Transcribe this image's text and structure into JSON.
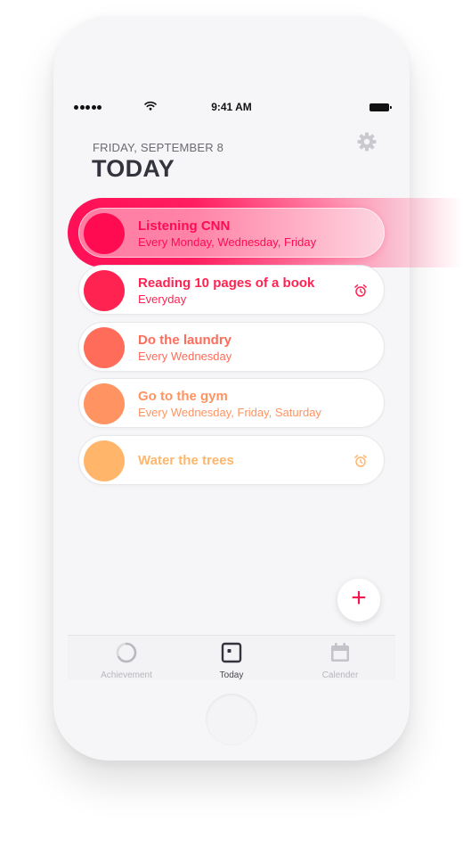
{
  "status_bar": {
    "time": "9:41 AM"
  },
  "header": {
    "date": "FRIDAY, SEPTEMBER 8",
    "title": "TODAY",
    "settings_icon": "gear-icon"
  },
  "colors": {
    "habit_1": "#ff0b52",
    "habit_2": "#ff2352",
    "habit_3": "#ff6c5a",
    "habit_4": "#ff9462",
    "habit_5": "#ffb66b"
  },
  "habits": [
    {
      "name": "Listening CNN",
      "frequency": "Every Monday, Wednesday, Friday",
      "alarm": false,
      "active": true
    },
    {
      "name": "Reading 10 pages of a book",
      "frequency": "Everyday",
      "alarm": true,
      "active": false
    },
    {
      "name": "Do the laundry",
      "frequency": "Every Wednesday",
      "alarm": false,
      "active": false
    },
    {
      "name": "Go to the gym",
      "frequency": "Every Wednesday, Friday, Saturday",
      "alarm": false,
      "active": false
    },
    {
      "name": "Water the trees",
      "frequency": "",
      "alarm": true,
      "active": false
    }
  ],
  "fab": {
    "label": "+"
  },
  "tabs": [
    {
      "label": "Achievement",
      "icon": "progress-ring-icon"
    },
    {
      "label": "Today",
      "icon": "today-icon",
      "selected": true
    },
    {
      "label": "Calender",
      "icon": "calendar-icon"
    }
  ]
}
